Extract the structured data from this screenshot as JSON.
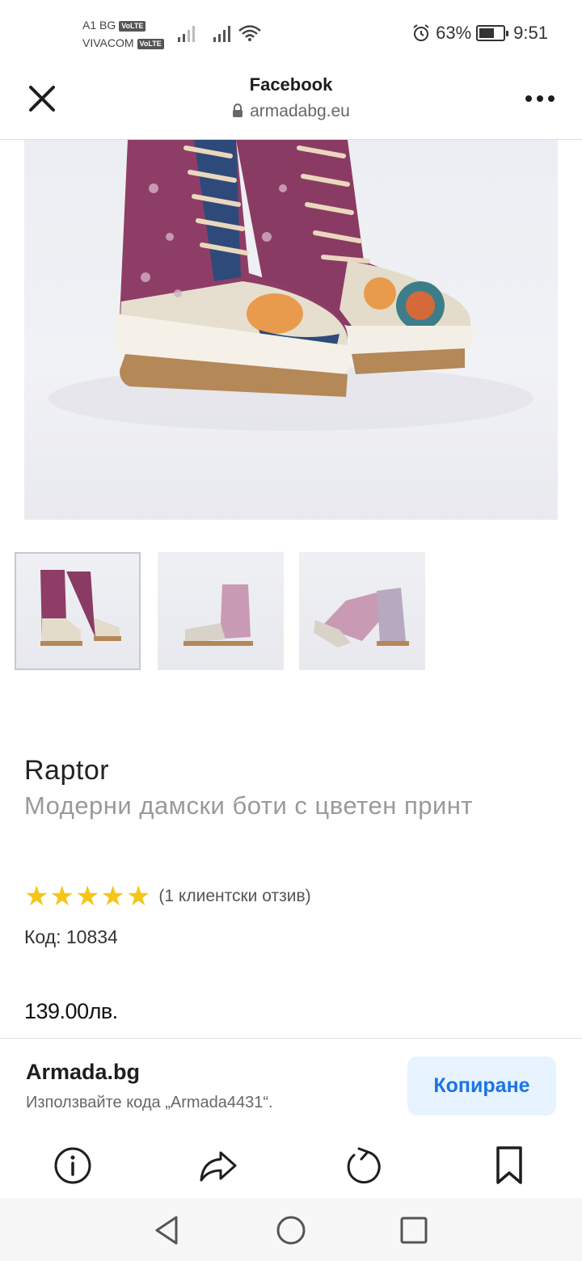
{
  "status_bar": {
    "carrier1": "A1 BG",
    "carrier2": "VIVACOM",
    "volte": "VoLTE",
    "battery_percent": "63%",
    "battery_level": 0.63,
    "time": "9:51"
  },
  "header": {
    "title": "Facebook",
    "url": "armadabg.eu"
  },
  "product": {
    "name": "Raptor",
    "subtitle": "Модерни дамски боти с цветен принт",
    "rating_stars": 5,
    "rating_text": "(1 клиентски отзив)",
    "sku": "Код: 10834",
    "price": "139.00лв."
  },
  "promo": {
    "name": "Armada.bg",
    "description": "Използвайте кода „Armada4431“.",
    "copy_label": "Копиране"
  },
  "colors": {
    "accent": "#1b74e4",
    "accent_bg": "#e7f3ff",
    "star": "#f5c518",
    "boot_magenta": "#8e3d66",
    "boot_cream": "#e4dccb",
    "sole": "#b48857"
  }
}
